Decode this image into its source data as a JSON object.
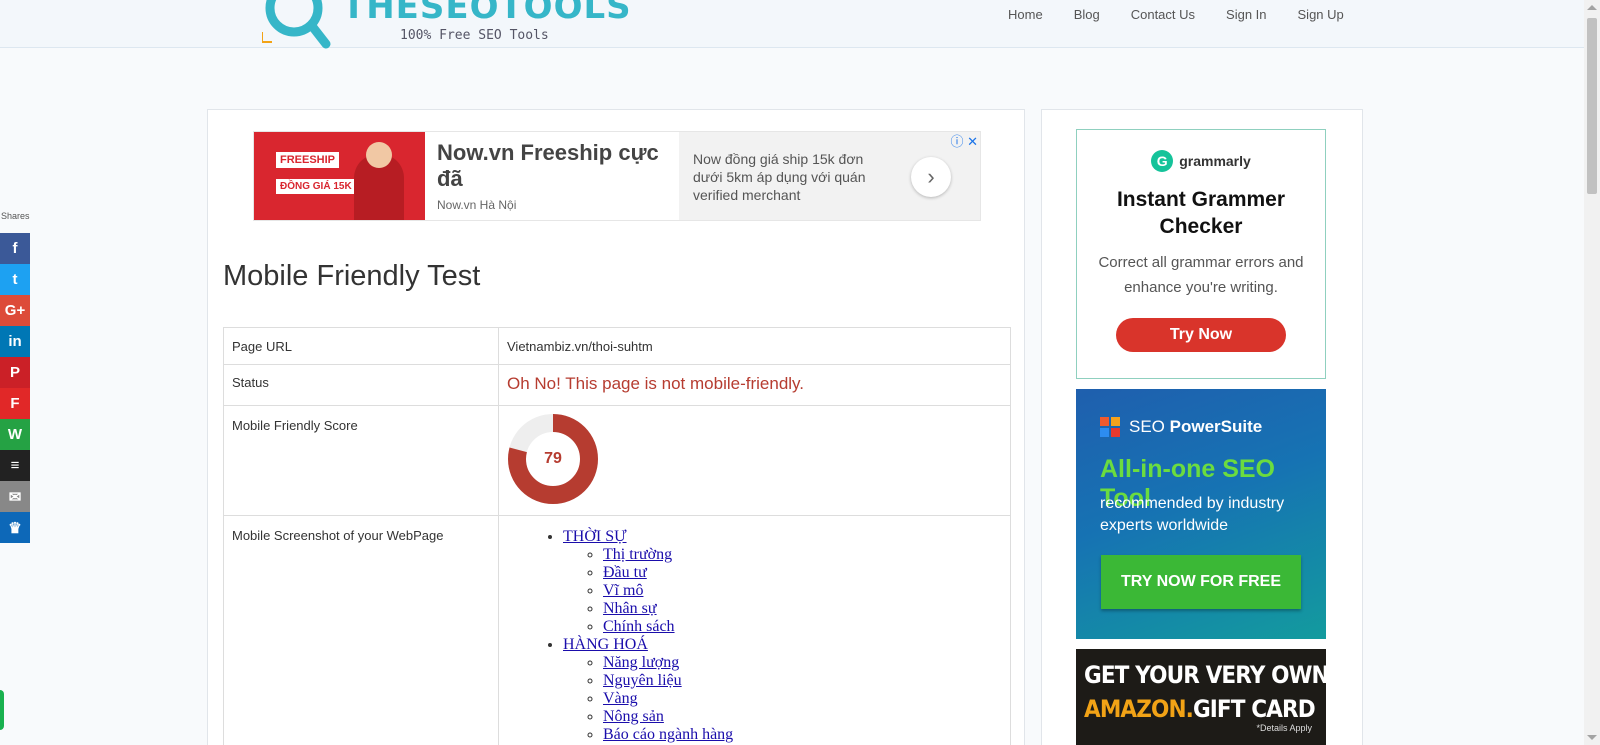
{
  "header": {
    "logo_text": "THESEOTOOLS",
    "logo_tagline": "100% Free SEO Tools",
    "nav": [
      "Home",
      "Blog",
      "Contact Us",
      "Sign In",
      "Sign Up"
    ]
  },
  "share": {
    "label": "Shares",
    "buttons": [
      {
        "name": "facebook",
        "glyph": "f",
        "color": "#3b5998"
      },
      {
        "name": "twitter",
        "glyph": "t",
        "color": "#1da1f2"
      },
      {
        "name": "google-plus",
        "glyph": "G+",
        "color": "#dd4b39"
      },
      {
        "name": "linkedin",
        "glyph": "in",
        "color": "#0077b5"
      },
      {
        "name": "pinterest",
        "glyph": "P",
        "color": "#cb2027"
      },
      {
        "name": "flipboard",
        "glyph": "F",
        "color": "#e12828"
      },
      {
        "name": "whatsapp",
        "glyph": "W",
        "color": "#25a244"
      },
      {
        "name": "buffer",
        "glyph": "≡",
        "color": "#222222"
      },
      {
        "name": "email",
        "glyph": "✉",
        "color": "#888888"
      },
      {
        "name": "sumome",
        "glyph": "♛",
        "color": "#0d68b8"
      }
    ]
  },
  "ad": {
    "image_tag1": "FREESHIP",
    "image_tag2": "ĐỒNG GIÁ 15K",
    "title": "Now.vn Freeship cực đã",
    "source": "Now.vn Hà Nội",
    "description": "Now đồng giá ship 15k đơn dưới 5km áp dụng với quán verified merchant",
    "next_glyph": "›",
    "close_glyph": "ⓘ ✕"
  },
  "main": {
    "title": "Mobile Friendly Test",
    "rows": {
      "url_label": "Page URL",
      "url_value": "Vietnambiz.vn/thoi-suhtm",
      "status_label": "Status",
      "status_value": "Oh No! This page is not mobile-friendly.",
      "score_label": "Mobile Friendly Score",
      "score_value": "79",
      "screenshot_label": "Mobile Screenshot of your WebPage"
    },
    "score_fraction": 0.79,
    "screenshot_menu": [
      {
        "label": "THỜI SỰ",
        "children": [
          "Thị trường",
          "Đầu tư",
          "Vĩ mô",
          "Nhân sự",
          "Chính sách"
        ]
      },
      {
        "label": "HÀNG HOÁ",
        "children": [
          "Năng lượng",
          "Nguyên liệu",
          "Vàng",
          "Nông sản",
          "Báo cáo ngành hàng"
        ]
      }
    ]
  },
  "sidebar": {
    "grammarly": {
      "brand": "grammarly",
      "headline": "Instant Grammer Checker",
      "sub": "Correct all grammar errors and enhance you're writing.",
      "button": "Try Now"
    },
    "seo": {
      "brand_prefix": "SEO",
      "brand_name": "PowerSuite",
      "headline": "All-in-one SEO Tool",
      "sub": "recommended by industry experts worldwide",
      "button": "TRY NOW FOR FREE"
    },
    "amazon": {
      "line1": "GET YOUR VERY OWN",
      "brand": "AMAZON.",
      "line2_rest": "GIFT CARD",
      "details": "*Details Apply"
    }
  },
  "colors": {
    "accent": "#36b6c8",
    "error": "#b63c30",
    "gauge_track": "#eeeeee"
  }
}
